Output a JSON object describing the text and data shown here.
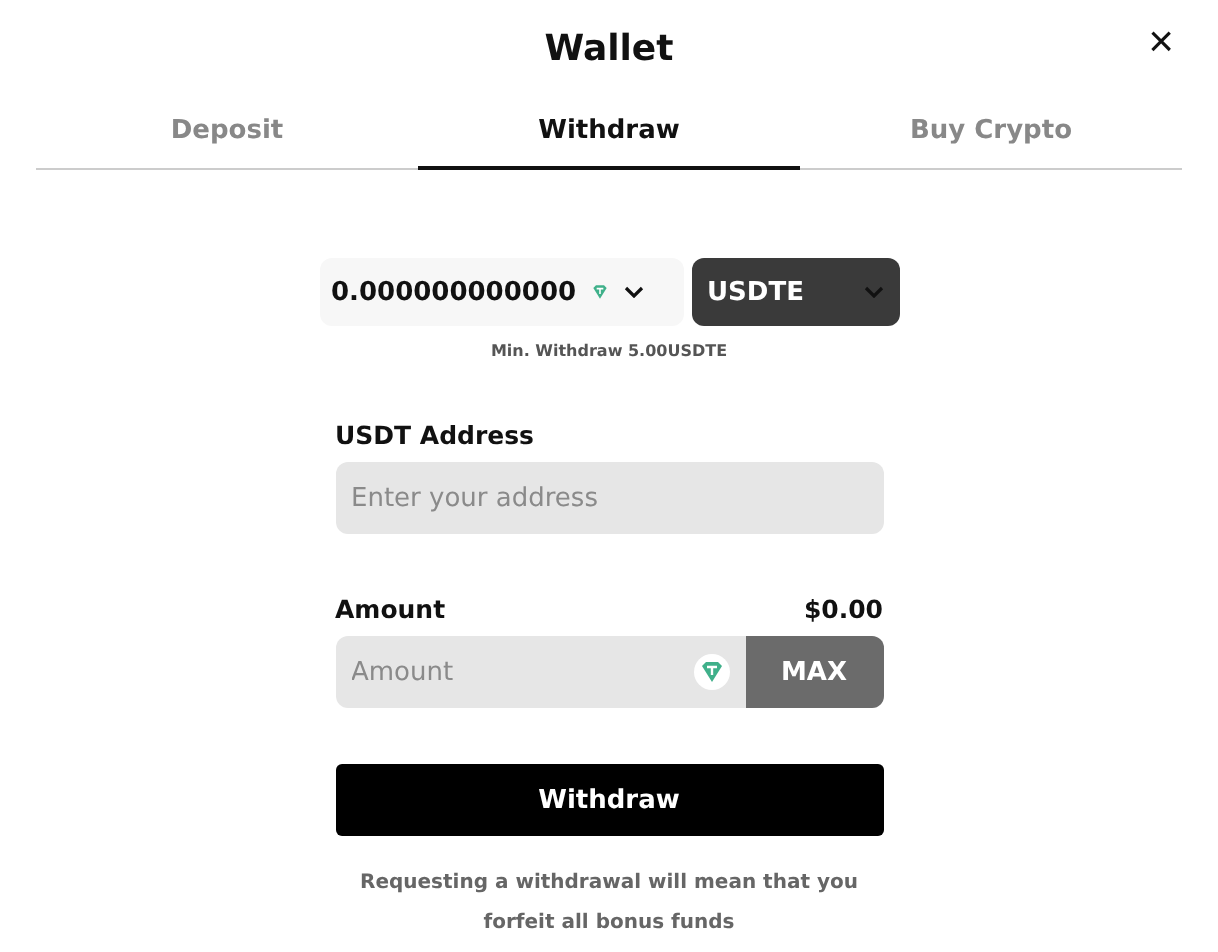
{
  "window": {
    "title": "Wallet",
    "close": "×"
  },
  "tabs": [
    {
      "label": "Deposit",
      "selected": false
    },
    {
      "label": "Withdraw",
      "selected": true
    },
    {
      "label": "Buy Crypto",
      "selected": false
    }
  ],
  "balance": {
    "value": "0.000000000000",
    "currency": "USDTE",
    "min_note": "Min. Withdraw 5.00USDTE"
  },
  "address": {
    "label": "USDT Address",
    "placeholder": "Enter your address"
  },
  "amount": {
    "label": "Amount",
    "value_usd": "$0.00",
    "placeholder": "Amount",
    "max": "MAX"
  },
  "submit": "Withdraw",
  "note": "Requesting a withdrawal will mean that you forfeit all bonus funds"
}
